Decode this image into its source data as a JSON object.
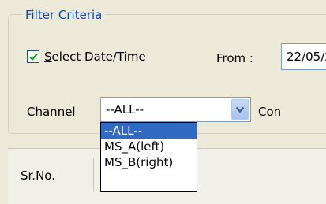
{
  "filter": {
    "legend": "Filter Criteria",
    "checkbox": {
      "checked": true,
      "accel": "S",
      "rest": "elect Date/Time"
    },
    "from_label": "From :",
    "from_value": "22/05/2",
    "channel": {
      "accel": "C",
      "rest": "hannel",
      "selected": "--ALL--",
      "options": [
        "--ALL--",
        "MS_A(left)",
        "MS_B(right)"
      ]
    },
    "con_label": {
      "accel": "C",
      "rest": "on"
    }
  },
  "table": {
    "header_srno": "Sr.No."
  },
  "colors": {
    "legend": "#0046d5",
    "selection": "#316ac5",
    "checkmark": "#21a121"
  }
}
